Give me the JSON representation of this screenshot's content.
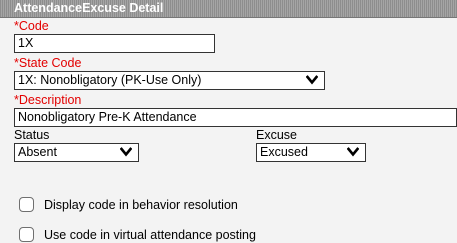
{
  "header": {
    "title": "AttendanceExcuse Detail"
  },
  "code": {
    "label": "*Code",
    "value": "1X"
  },
  "state_code": {
    "label": "*State Code",
    "selected": "1X: Nonobligatory (PK-Use Only)"
  },
  "description": {
    "label": "*Description",
    "value": "Nonobligatory Pre-K Attendance"
  },
  "status": {
    "label": "Status",
    "selected": "Absent"
  },
  "excuse": {
    "label": "Excuse",
    "selected": "Excused"
  },
  "checkboxes": [
    {
      "label": "Display code in behavior resolution",
      "checked": false
    },
    {
      "label": "Use code in virtual attendance posting",
      "checked": false
    }
  ],
  "colors": {
    "required": "#e30000",
    "header_bg": "#999999",
    "panel_bg": "#f3f3f3"
  },
  "icons": {
    "dropdown": "chevron-down-icon"
  }
}
